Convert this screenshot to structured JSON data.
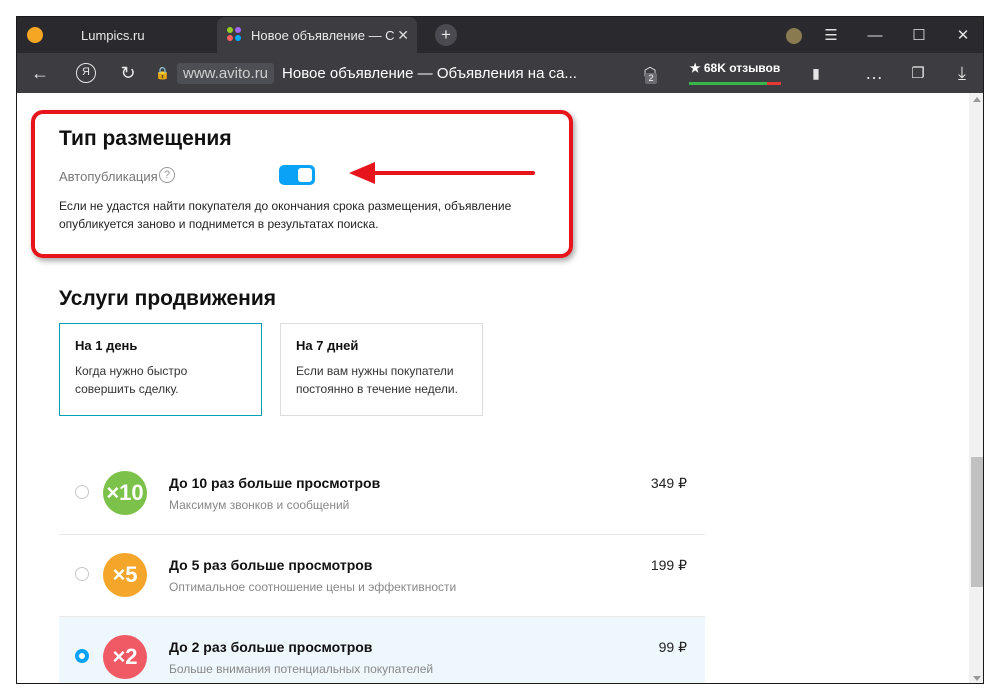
{
  "browser": {
    "tabs": [
      {
        "label": "Lumpics.ru",
        "favicon_color": "#f5a623"
      },
      {
        "label": "Новое объявление — С",
        "active": true
      }
    ],
    "new_tab": "+",
    "window_controls": [
      "☰",
      "—",
      "☐",
      "✕"
    ],
    "nav": {
      "back": "←",
      "yandex": "Я",
      "reload": "↻"
    },
    "url": {
      "domain": "www.avito.ru",
      "page_title": "Новое объявление — Объявления на са..."
    },
    "extension_badge": "2",
    "reviews": "★ 68K отзывов"
  },
  "placement": {
    "title": "Тип размещения",
    "autopublish_label": "Автопубликация",
    "help": "?",
    "autopublish_on": true,
    "description": "Если не удастся найти покупателя до окончания срока размещения, объявление опубликуется заново и поднимется в результатах поиска."
  },
  "promotion": {
    "title": "Услуги продвижения",
    "cards": [
      {
        "title": "На 1 день",
        "desc_line1": "Когда нужно быстро",
        "desc_line2": "совершить сделку.",
        "active": true
      },
      {
        "title": "На 7 дней",
        "desc_line1": "Если вам нужны покупатели",
        "desc_line2": "постоянно в течение недели.",
        "active": false
      }
    ],
    "services": [
      {
        "badge": "×10",
        "badge_color": "#7cc24a",
        "title": "До 10 раз больше просмотров",
        "subtitle": "Максимум звонков и сообщений",
        "price": "349 ₽",
        "selected": false
      },
      {
        "badge": "×5",
        "badge_color": "#f4a62a",
        "title": "До 5 раз больше просмотров",
        "subtitle": "Оптимальное соотношение цены и эффективности",
        "price": "199 ₽",
        "selected": false
      },
      {
        "badge": "×2",
        "badge_color": "#f05a64",
        "title": "До 2 раз больше просмотров",
        "subtitle": "Больше внимания потенциальных покупателей",
        "price": "99 ₽",
        "selected": true
      }
    ]
  }
}
